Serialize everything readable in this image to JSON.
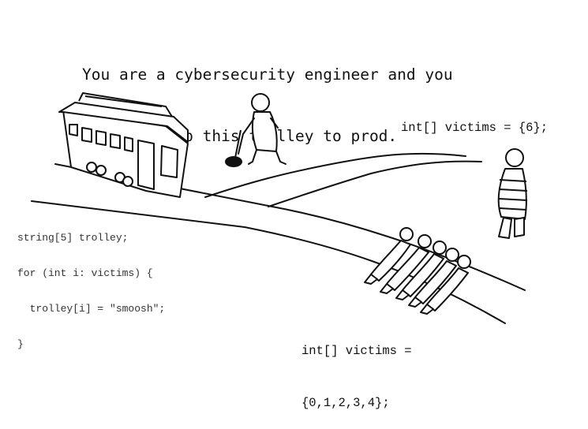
{
  "caption": {
    "line1": "You are a cybersecurity engineer and you",
    "line2": "need to ship this trolley to prod."
  },
  "code_left": {
    "lines": [
      "string[5] trolley;",
      "for (int i: victims) {",
      "  trolley[i] = \"smoosh\";",
      "}"
    ]
  },
  "code_top": "int[] victims = {6};",
  "code_bottom": {
    "line1": "int[] victims =",
    "line2": "{0,1,2,3,4};"
  },
  "colors": {
    "ink": "#111111",
    "background": "#ffffff"
  }
}
